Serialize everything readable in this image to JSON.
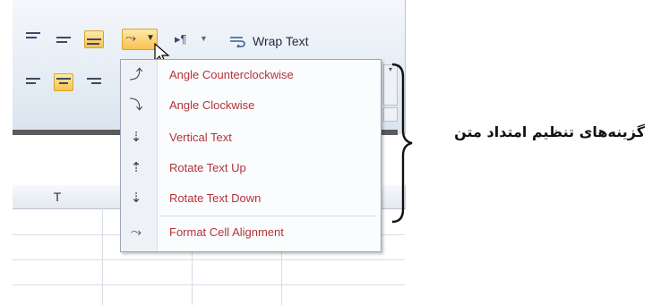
{
  "ribbon": {
    "wrap_text_label": "Wrap Text"
  },
  "sheet": {
    "column_header": "T"
  },
  "menu": {
    "items": [
      {
        "label": "Angle Counterclockwise",
        "icon": "angle-counterclockwise-icon"
      },
      {
        "label": "Angle Clockwise",
        "icon": "angle-clockwise-icon"
      },
      {
        "label": "Vertical Text",
        "icon": "vertical-text-icon"
      },
      {
        "label": "Rotate Text Up",
        "icon": "rotate-text-up-icon"
      },
      {
        "label": "Rotate Text Down",
        "icon": "rotate-text-down-icon"
      },
      {
        "label": "Format Cell Alignment",
        "icon": "format-cell-alignment-icon"
      }
    ]
  },
  "annotation": {
    "text": "گزینه‌های تنظیم امتداد متن"
  },
  "colors": {
    "menu_label": "#b2343a",
    "active_button": "#f8c250",
    "ribbon_bg": "#e6edf5"
  }
}
